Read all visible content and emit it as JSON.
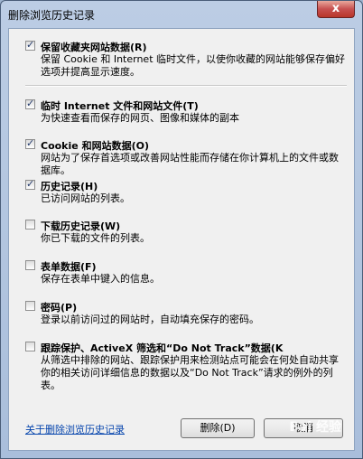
{
  "window": {
    "title": "删除浏览历史记录",
    "close_glyph": "x"
  },
  "options": [
    {
      "checked": true,
      "title": "保留收藏夹网站数据(R)",
      "desc": "保留 Cookie 和 Internet 临时文件，以使你收藏的网站能够保存偏好选项并提高显示速度。"
    },
    {
      "checked": true,
      "title": "临时 Internet 文件和网站文件(T)",
      "desc": "为快速查看而保存的网页、图像和媒体的副本"
    },
    {
      "checked": true,
      "title": "Cookie 和网站数据(O)",
      "desc": "网站为了保存首选项或改善网站性能而存储在你计算机上的文件或数据库。"
    },
    {
      "checked": true,
      "title": "历史记录(H)",
      "desc": "已访问网站的列表。"
    },
    {
      "checked": false,
      "title": "下载历史记录(W)",
      "desc": "你已下载的文件的列表。"
    },
    {
      "checked": false,
      "title": "表单数据(F)",
      "desc": "保存在表单中键入的信息。"
    },
    {
      "checked": false,
      "title": "密码(P)",
      "desc": "登录以前访问过的网站时，自动填充保存的密码。"
    },
    {
      "checked": false,
      "title": "跟踪保护、ActiveX 筛选和“Do Not Track”数据(K",
      "desc": "从筛选中排除的网站、跟踪保护用来检测站点可能会在何处自动共享你的相关访问详细信息的数据以及“Do Not Track”请求的例外的列表。"
    }
  ],
  "footer": {
    "about_link": "关于删除浏览历史记录",
    "delete_label": "删除(D)",
    "cancel_label": "取消"
  },
  "watermark": "Bai 经验"
}
